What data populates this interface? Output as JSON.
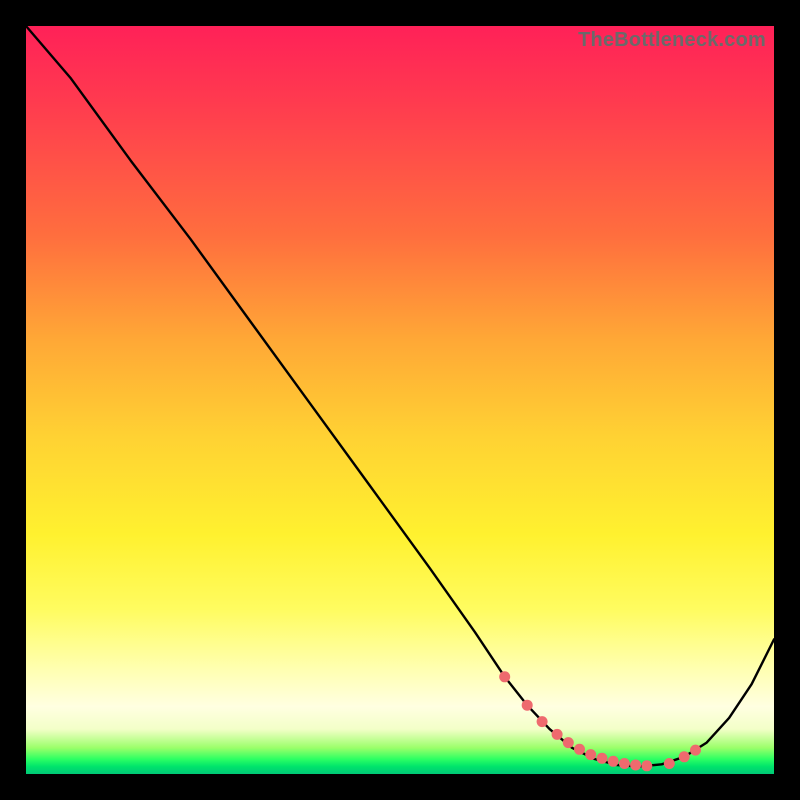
{
  "attribution": "TheBottleneck.com",
  "chart_data": {
    "type": "line",
    "title": "",
    "xlabel": "",
    "ylabel": "",
    "xlim": [
      0,
      100
    ],
    "ylim": [
      0,
      100
    ],
    "grid": false,
    "legend": false,
    "series": [
      {
        "name": "curve",
        "color": "#000000",
        "x": [
          0,
          6,
          14,
          22,
          30,
          38,
          46,
          54,
          60,
          64,
          67,
          70,
          73,
          76,
          79,
          82,
          85,
          88,
          91,
          94,
          97,
          100
        ],
        "y": [
          100,
          93,
          82,
          71.5,
          60.5,
          49.5,
          38.5,
          27.5,
          19,
          13,
          9.2,
          6,
          3.5,
          2,
          1.2,
          1,
          1.3,
          2.3,
          4.2,
          7.5,
          12,
          18
        ]
      }
    ],
    "markers": {
      "name": "trough-dots",
      "color": "#ee6a6e",
      "x": [
        64,
        67,
        69,
        71,
        72.5,
        74,
        75.5,
        77,
        78.5,
        80,
        81.5,
        83,
        86,
        88,
        89.5
      ],
      "y": [
        13,
        9.2,
        7.0,
        5.3,
        4.2,
        3.3,
        2.6,
        2.1,
        1.7,
        1.4,
        1.2,
        1.1,
        1.4,
        2.3,
        3.2
      ]
    },
    "background_gradient": {
      "orientation": "vertical",
      "stops": [
        {
          "pos": 0.0,
          "color": "#ff2158"
        },
        {
          "pos": 0.28,
          "color": "#ff6e3e"
        },
        {
          "pos": 0.55,
          "color": "#ffd233"
        },
        {
          "pos": 0.78,
          "color": "#fffc60"
        },
        {
          "pos": 0.94,
          "color": "#f3ffc8"
        },
        {
          "pos": 1.0,
          "color": "#00c877"
        }
      ]
    }
  }
}
